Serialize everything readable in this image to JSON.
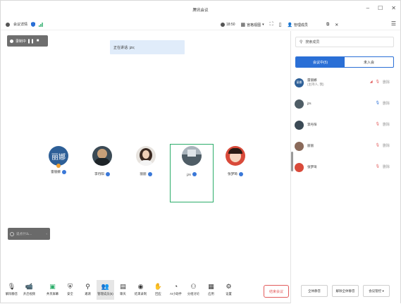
{
  "window": {
    "title": "腾讯会议",
    "minimize": "–",
    "maximize": "☐",
    "close": "✕"
  },
  "infobar": {
    "meeting_info": "会议详情",
    "time": "18:50",
    "view": "宫格视图",
    "manage": "管理成员",
    "menu": "☰"
  },
  "recording": {
    "label": "录制中"
  },
  "speaking": {
    "text": "正在讲话: jzs;"
  },
  "participants_grid": [
    {
      "name": "雷丽娜",
      "avatar_text": "丽娜"
    },
    {
      "name": "李丹阳"
    },
    {
      "name": "丽丽"
    },
    {
      "name": "jzs"
    },
    {
      "name": "张梦琦"
    }
  ],
  "chat": {
    "placeholder": "说点什么..."
  },
  "toolbar": {
    "items": [
      {
        "label": "解除静音"
      },
      {
        "label": "开启视频"
      },
      {
        "label": "共享屏幕"
      },
      {
        "label": "安全"
      },
      {
        "label": "邀请"
      },
      {
        "label": "管理成员(5)"
      },
      {
        "label": "聊天"
      },
      {
        "label": "结束录制"
      },
      {
        "label": "回应"
      },
      {
        "label": "AI小助手"
      },
      {
        "label": "分组讨论"
      },
      {
        "label": "应用"
      },
      {
        "label": "设置"
      }
    ],
    "leave": "结束会议"
  },
  "panel": {
    "search_placeholder": "搜索成员",
    "tab_in": "会议中(5)",
    "tab_out": "未入会",
    "members": [
      {
        "name": "雷丽娜",
        "sub": "(主持人, 我)",
        "avatar_text": "丽娜",
        "tag": "删除"
      },
      {
        "name": "jzs",
        "tag": "删除"
      },
      {
        "name": "李丹阳",
        "tag": "删除"
      },
      {
        "name": "丽丽",
        "tag": "删除"
      },
      {
        "name": "张梦琦",
        "tag": "删除"
      }
    ],
    "btn_mute_all": "全体静音",
    "btn_unmute_all": "解除全体静音",
    "btn_control": "会议管控 ▾"
  },
  "colors": {
    "accent": "#2a6fd6",
    "active_border": "#2cad6a",
    "leave": "#e25b5b"
  }
}
